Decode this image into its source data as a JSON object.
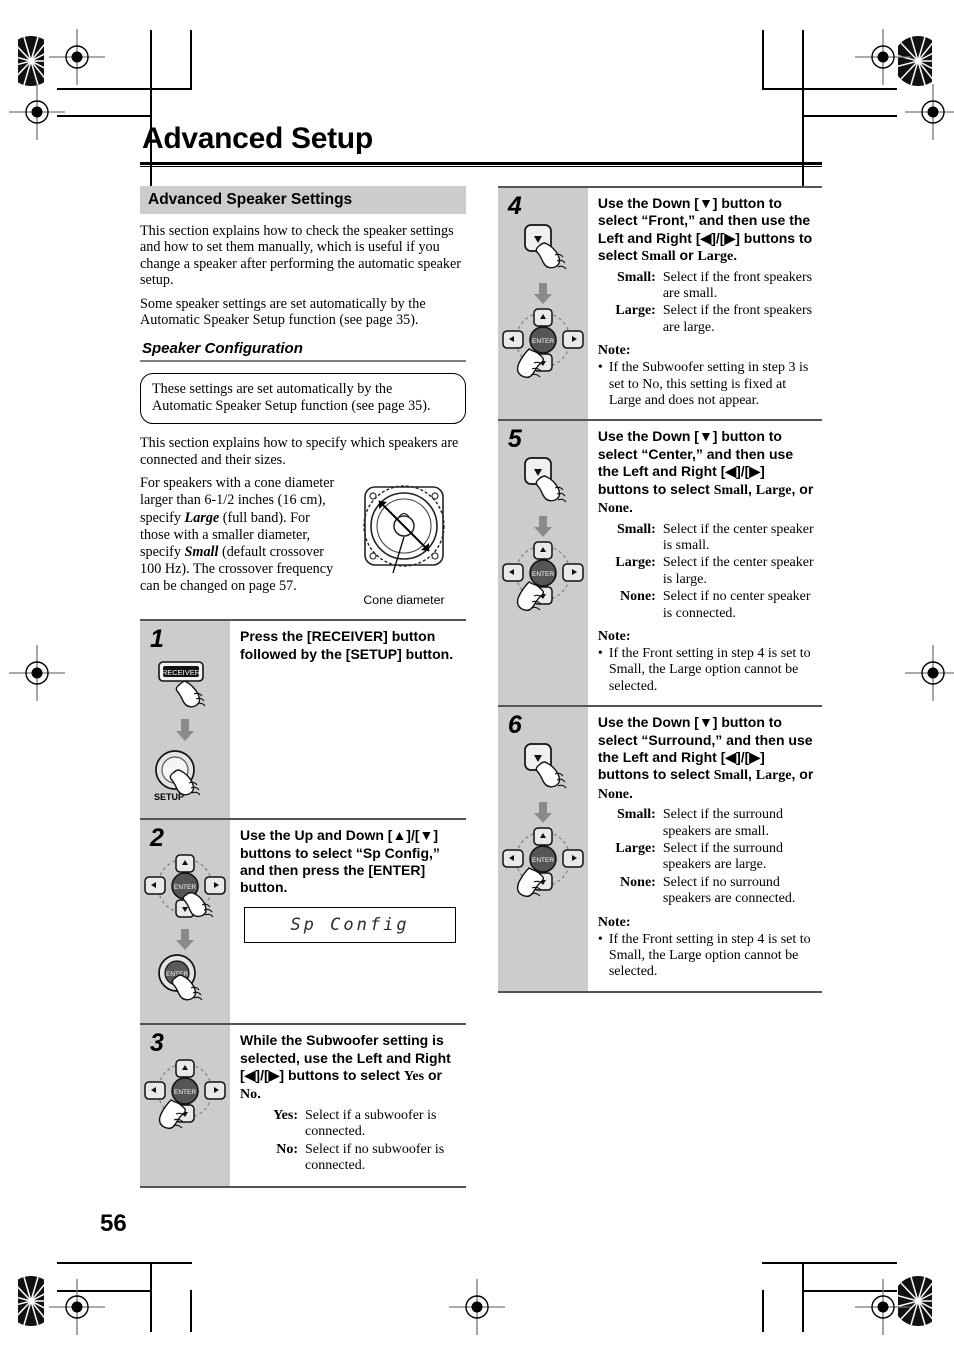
{
  "page": {
    "title": "Advanced Setup",
    "number": "56"
  },
  "section": {
    "band_label": "Advanced Speaker Settings",
    "intro_1": "This section explains how to check the speaker settings and how to set them manually, which is useful if you change a speaker after performing the automatic speaker setup.",
    "intro_2": "Some speaker settings are set automatically by the Automatic Speaker Setup function (see page 35).",
    "subhead": "Speaker Configuration",
    "callout": "These settings are set automatically by the Automatic Speaker Setup function (see page 35).",
    "body_1": "This section explains how to specify which speakers are connected and their sizes.",
    "cone_text_1": "For speakers with a cone diameter larger than 6-1/2 inches (16 cm), specify ",
    "cone_em_1": "Large",
    "cone_text_2": " (full band). For those with a smaller diameter, specify ",
    "cone_em_2": "Small",
    "cone_text_3": " (default crossover 100 Hz). The crossover frequency can be changed on page 57.",
    "cone_caption": "Cone diameter"
  },
  "steps": [
    {
      "number": "1",
      "art": "receiver-then-setup",
      "button_label_1": "RECEIVER",
      "button_label_2": "SETUP",
      "head": "Press the [RECEIVER] button followed by the [SETUP] button.",
      "defs": [],
      "note_title": "",
      "notes": [],
      "lcd": ""
    },
    {
      "number": "2",
      "art": "dpad-then-enter",
      "enter_label": "ENTER",
      "head": "Use the Up and Down [▲]/[▼] buttons to select “Sp Config,” and then press the [ENTER] button.",
      "defs": [],
      "note_title": "",
      "notes": [],
      "lcd": "Sp Config"
    },
    {
      "number": "3",
      "art": "dpad",
      "enter_label": "ENTER",
      "head_parts": [
        {
          "t": "While the Subwoofer setting is selected, use the Left and Right [◀]/[▶] buttons to select ",
          "s": "plain"
        },
        {
          "t": "Yes",
          "s": "serif-bold"
        },
        {
          "t": " or ",
          "s": "plain"
        },
        {
          "t": "No",
          "s": "serif-bold"
        },
        {
          "t": ".",
          "s": "plain"
        }
      ],
      "defs": [
        {
          "term": "Yes:",
          "desc": "Select if a subwoofer is connected."
        },
        {
          "term": "No:",
          "desc": "Select if no subwoofer is connected."
        }
      ],
      "note_title": "",
      "notes": [],
      "lcd": ""
    },
    {
      "number": "4",
      "art": "down-then-dpad",
      "enter_label": "ENTER",
      "head_parts": [
        {
          "t": "Use the Down [▼] button to select “Front,” and then use the Left and Right [◀]/[▶] buttons to select ",
          "s": "plain"
        },
        {
          "t": "Small",
          "s": "serif-bold"
        },
        {
          "t": " or ",
          "s": "plain"
        },
        {
          "t": "Large",
          "s": "serif-bold"
        },
        {
          "t": ".",
          "s": "plain"
        }
      ],
      "defs": [
        {
          "term": "Small:",
          "desc": "Select if the front speakers are small."
        },
        {
          "term": "Large:",
          "desc": "Select if the front speakers are large."
        }
      ],
      "note_title": "Note:",
      "notes": [
        "If the Subwoofer setting in step 3 is set to No, this setting is fixed at Large and does not appear."
      ],
      "lcd": ""
    },
    {
      "number": "5",
      "art": "down-then-dpad",
      "enter_label": "ENTER",
      "head_parts": [
        {
          "t": "Use the Down [▼] button to select “Center,” and then use the Left and Right [◀]/[▶] buttons to select ",
          "s": "plain"
        },
        {
          "t": "Small",
          "s": "serif-bold"
        },
        {
          "t": ", ",
          "s": "plain"
        },
        {
          "t": "Large",
          "s": "serif-bold"
        },
        {
          "t": ", or ",
          "s": "plain"
        },
        {
          "t": "None",
          "s": "serif-bold"
        },
        {
          "t": ".",
          "s": "plain"
        }
      ],
      "defs": [
        {
          "term": "Small:",
          "desc": "Select if the center speaker is small."
        },
        {
          "term": "Large:",
          "desc": "Select if the center speaker is large."
        },
        {
          "term": "None:",
          "desc": "Select if no center speaker is connected."
        }
      ],
      "note_title": "Note:",
      "notes": [
        "If the Front setting in step 4 is set to Small, the Large option cannot be selected."
      ],
      "lcd": ""
    },
    {
      "number": "6",
      "art": "down-then-dpad",
      "enter_label": "ENTER",
      "head_parts": [
        {
          "t": "Use the Down [▼] button to select “Surround,” and then use the Left and Right [◀]/[▶] buttons to select ",
          "s": "plain"
        },
        {
          "t": "Small",
          "s": "serif-bold"
        },
        {
          "t": ", ",
          "s": "plain"
        },
        {
          "t": "Large",
          "s": "serif-bold"
        },
        {
          "t": ", or ",
          "s": "plain"
        },
        {
          "t": "None",
          "s": "serif-bold"
        },
        {
          "t": ".",
          "s": "plain"
        }
      ],
      "defs": [
        {
          "term": "Small:",
          "desc": "Select if the surround speakers are small."
        },
        {
          "term": "Large:",
          "desc": "Select if the surround speakers are large."
        },
        {
          "term": "None:",
          "desc": "Select if no surround speakers are connected."
        }
      ],
      "note_title": "Note:",
      "notes": [
        "If the Front setting in step 4 is set to Small, the Large option cannot be selected."
      ],
      "lcd": ""
    }
  ],
  "colors": {
    "band_gray": "#cccccc",
    "rule_gray": "#555555",
    "subrule_gray": "#808080"
  }
}
